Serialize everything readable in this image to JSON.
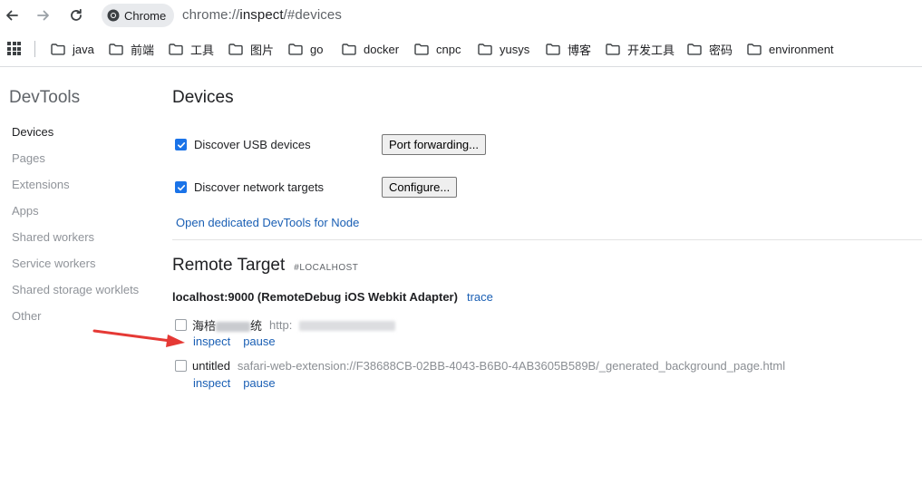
{
  "browser": {
    "chip_label": "Chrome",
    "url_scheme": "chrome://",
    "url_host": "inspect",
    "url_rest": "/#devices"
  },
  "bookmarks": [
    "java",
    "前端",
    "工具",
    "图片",
    "go",
    "docker",
    "cnpc",
    "yusys",
    "博客",
    "开发工具",
    "密码",
    "environment"
  ],
  "sidebar": {
    "title": "DevTools",
    "items": [
      "Devices",
      "Pages",
      "Extensions",
      "Apps",
      "Shared workers",
      "Service workers",
      "Shared storage worklets",
      "Other"
    ],
    "active": "Devices"
  },
  "main": {
    "title": "Devices",
    "discover_usb": "Discover USB devices",
    "discover_usb_checked": true,
    "port_forwarding_button": "Port forwarding...",
    "discover_network": "Discover network targets",
    "discover_network_checked": true,
    "configure_button": "Configure...",
    "node_link": "Open dedicated DevTools for Node",
    "remote_title": "Remote Target",
    "remote_sub": "#LOCALHOST",
    "device_name": "localhost:9000 (RemoteDebug iOS Webkit Adapter)",
    "trace_link": "trace",
    "targets": [
      {
        "title_start": "海棓",
        "title_end": "统",
        "url": "http:",
        "inspect": "inspect",
        "pause": "pause"
      },
      {
        "title": "untitled",
        "url": "safari-web-extension://F38688CB-02BB-4043-B6B0-4AB3605B589B/_generated_background_page.html",
        "inspect": "inspect",
        "pause": "pause"
      }
    ]
  },
  "colors": {
    "link": "#1a5fb4",
    "checkbox": "#1a73e8",
    "annotation_arrow": "#e53935"
  }
}
